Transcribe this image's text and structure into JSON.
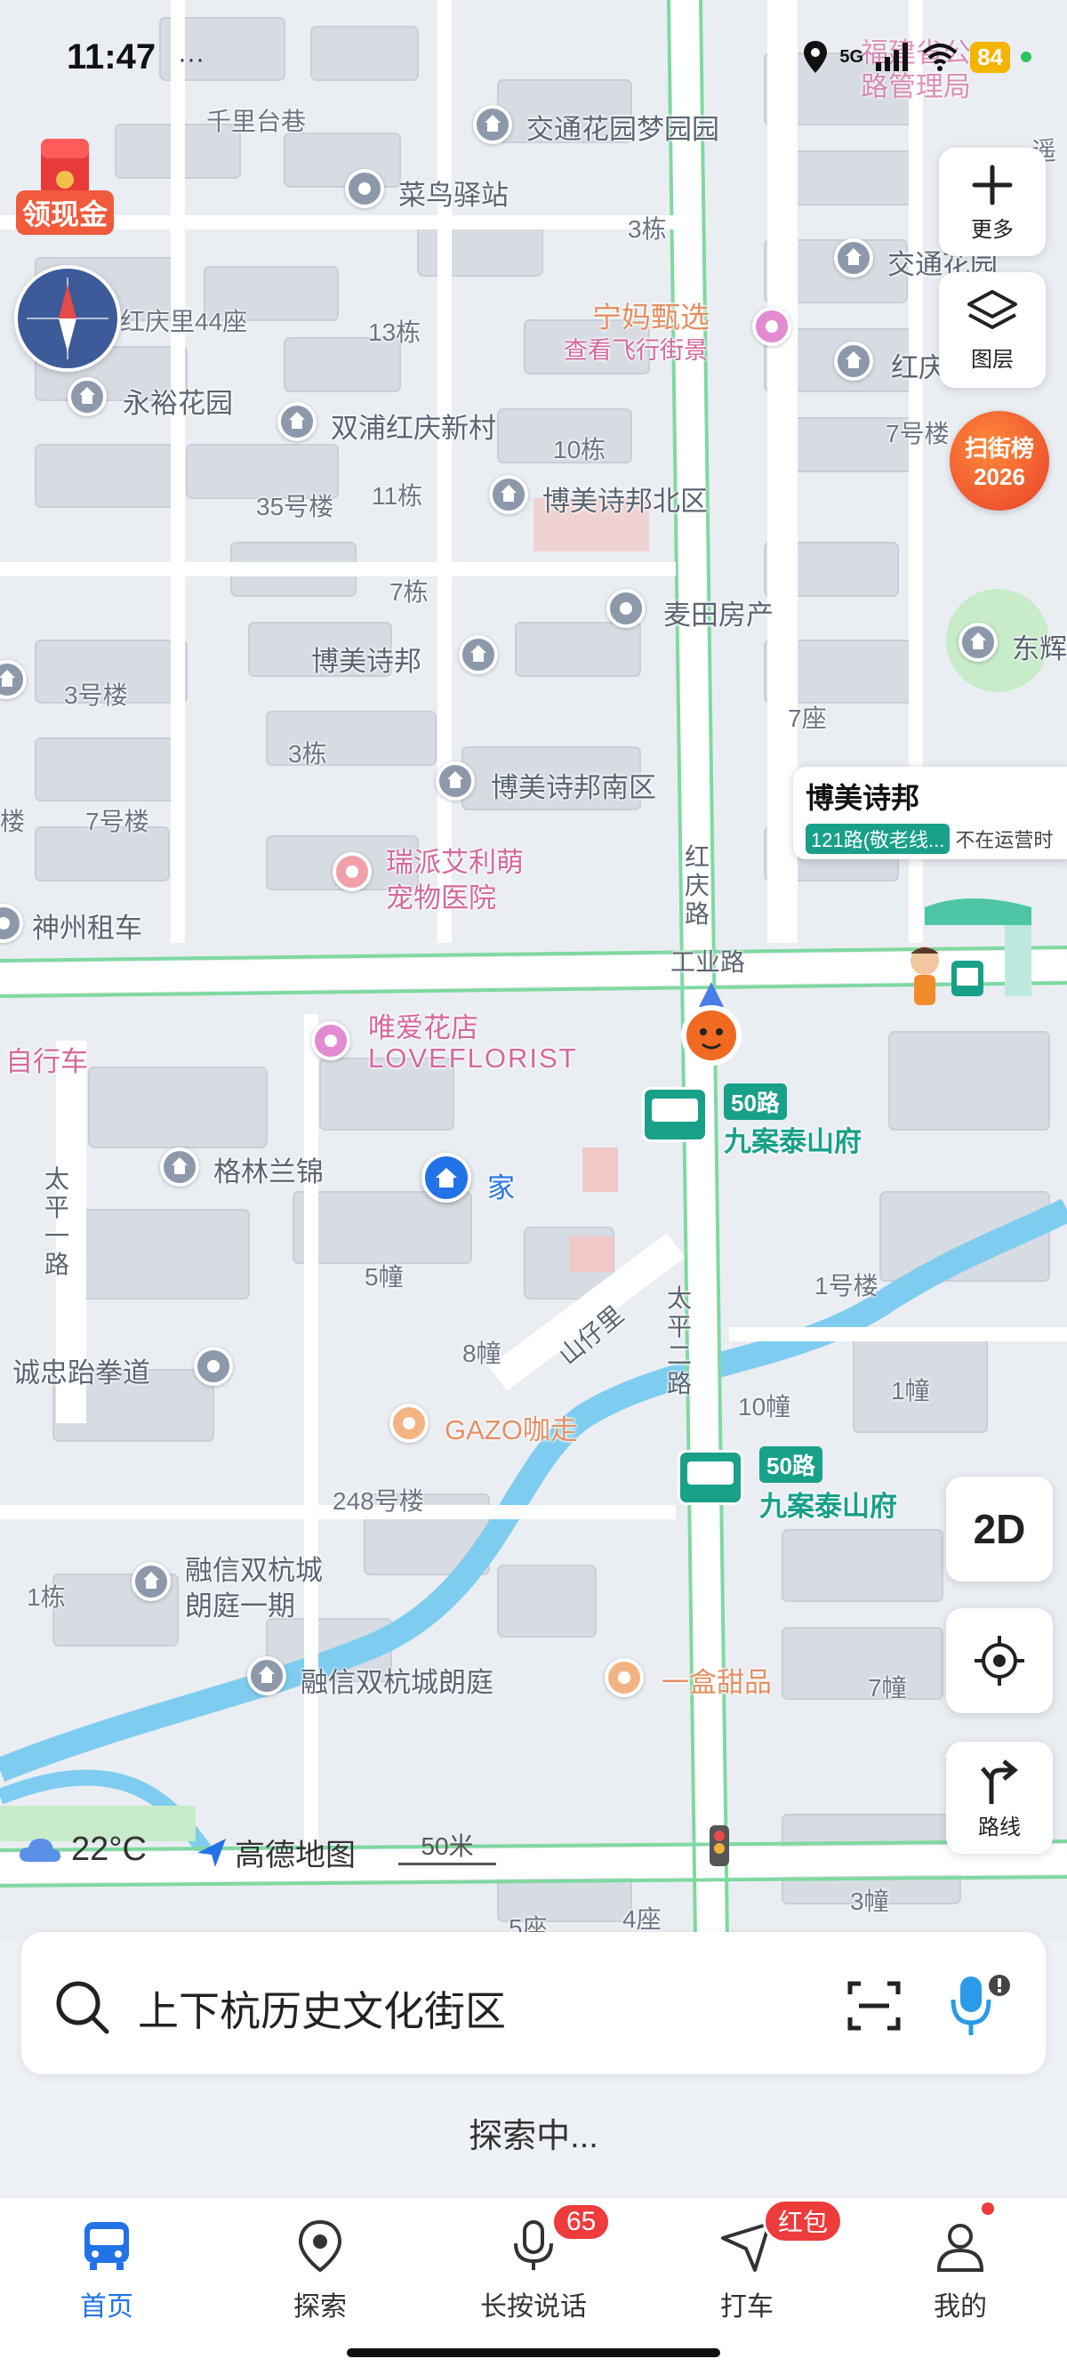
{
  "status_bar": {
    "time": "11:47",
    "network": "5G",
    "battery": "84",
    "extra_dots": "···"
  },
  "map": {
    "labels": {
      "qianlitai": "千里台巷",
      "jiaotong": "交通花园梦园园",
      "cainiao": "菜鸟驿站",
      "yao": "遥",
      "hongqingli": "红庆里44座",
      "b13": "13栋",
      "b3": "3栋",
      "jiaotong2": "交通花园",
      "yuyuan": "永裕花园",
      "ningma": "宁妈甄选",
      "feixing": "查看飞行街景",
      "hong": "红庆",
      "shuangpu": "双浦红庆新村",
      "b10": "10栋",
      "b7": "7号楼",
      "b35": "35号楼",
      "b11": "11栋",
      "bmsbbq": "博美诗邦北区",
      "b7d": "7栋",
      "maitian": "麦田房产",
      "dong": "东辉",
      "bmsb": "博美诗邦",
      "b3hl": "3号楼",
      "b7z": "7座",
      "b3d": "3栋",
      "bmsbnq": "博美诗邦南区",
      "lou": "楼",
      "b7hl": "7号楼",
      "ruipai": "瑞派艾利萌",
      "chongwu": "宠物医院",
      "shenzhou": "神州租车",
      "gongyelu": "工业路",
      "weiai": "唯爱花店",
      "loveflorist": "LOVEFLORIST",
      "zixingche": "自行车",
      "gelinlanjin": "格林兰锦",
      "jia": "家",
      "b5z": "5幢",
      "b8z": "8幢",
      "shanzaili": "山仔里",
      "b1hl": "1号楼",
      "b10z": "10幢",
      "b1z": "1幢",
      "chengzhong": "诚忠跆拳道",
      "gazo": "GAZO咖走",
      "b248": "248号楼",
      "rongxin1": "融信双杭城",
      "rongxin1b": "朗庭一期",
      "b1d": "1栋",
      "rongxin2": "融信双杭城朗庭",
      "yihe": "一盒甜品",
      "b7zz": "7幢",
      "b3z": "3幢",
      "b4z": "4座",
      "b5zz": "5座",
      "fujian1": "福建省公",
      "fujian2": "路管理局",
      "hongqinglu": "红庆路",
      "taiping2": "太平二路",
      "taiping1": "太平一路"
    },
    "bus": {
      "route_a": "50路",
      "stop_a": "九案泰山府",
      "route_b": "50路",
      "stop_b": "九案泰山府"
    },
    "stop_card": {
      "title": "博美诗邦",
      "route": "121路(敬老线...",
      "status": "不在运营时"
    },
    "weather": "22°C",
    "brand": "高德地图",
    "scale": "50米",
    "red_packet": "领现金",
    "saojie": "扫街榜",
    "saojie_year": "2026"
  },
  "controls": {
    "more": "更多",
    "layers": "图层",
    "view_mode": "2D",
    "route": "路线"
  },
  "search": {
    "text": "上下杭历史文化街区",
    "status": "探索中..."
  },
  "nav": [
    {
      "label": "首页"
    },
    {
      "label": "探索"
    },
    {
      "label": "长按说话",
      "badge": "65"
    },
    {
      "label": "打车",
      "badge": "红包"
    },
    {
      "label": "我的"
    }
  ],
  "colors": {
    "accent": "#2373e8",
    "road_green": "#7fd9a0",
    "bus_green": "#18a089",
    "water": "#7ecdf0",
    "badge_red": "#ee3b3b"
  }
}
